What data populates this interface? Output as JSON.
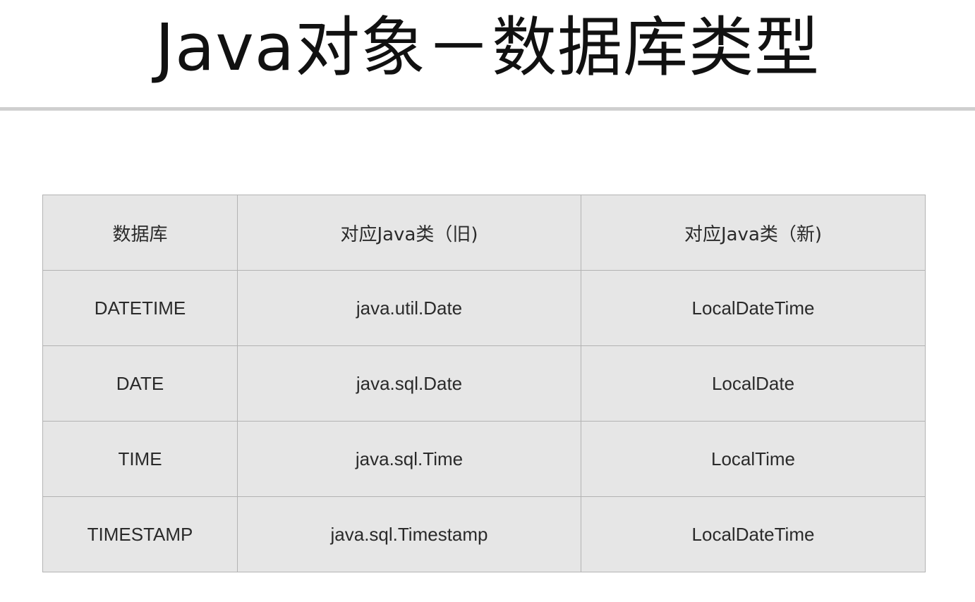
{
  "title": "Java对象－数据库类型",
  "table": {
    "headers": [
      "数据库",
      "对应Java类（旧)",
      "对应Java类（新)"
    ],
    "rows": [
      [
        "DATETIME",
        "java.util.Date",
        "LocalDateTime"
      ],
      [
        "DATE",
        "java.sql.Date",
        "LocalDate"
      ],
      [
        "TIME",
        "java.sql.Time",
        "LocalTime"
      ],
      [
        "TIMESTAMP",
        "java.sql.Timestamp",
        "LocalDateTime"
      ]
    ]
  }
}
